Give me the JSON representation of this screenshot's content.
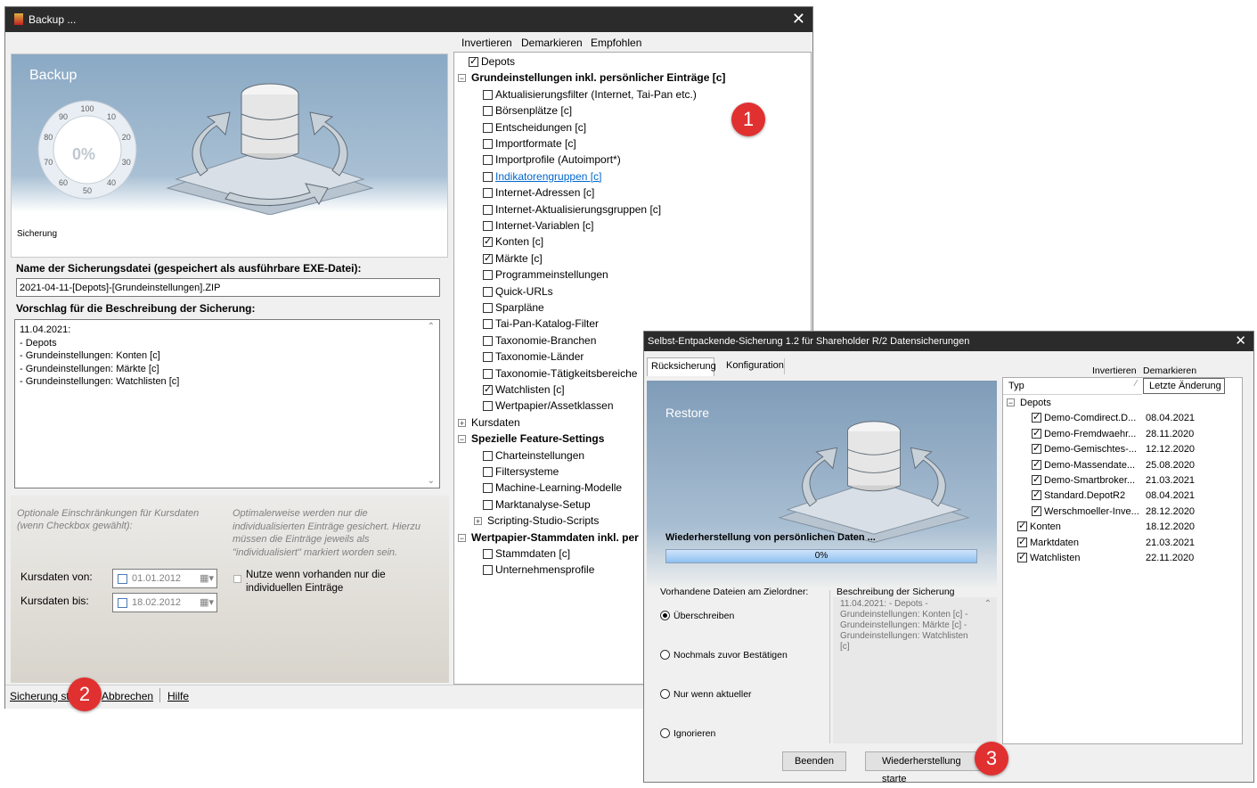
{
  "backup_window": {
    "title": "Backup ...",
    "banner_title": "Backup",
    "gauge_percent": "0%",
    "gauge_ticks": [
      "100",
      "10",
      "20",
      "30",
      "40",
      "50",
      "60",
      "70",
      "80",
      "90"
    ],
    "banner_status": "Sicherung",
    "file_label": "Name der Sicherungsdatei (gespeichert als ausführbare EXE-Datei):",
    "file_value": "2021-04-11-[Depots]-[Grundeinstellungen].ZIP",
    "desc_label": "Vorschlag für die Beschreibung der Sicherung:",
    "desc_lines": [
      "11.04.2021:",
      "- Depots",
      "- Grundeinstellungen: Konten [c]",
      "- Grundeinstellungen: Märkte [c]",
      "- Grundeinstellungen: Watchlisten [c]"
    ],
    "opt_left": "Optionale Einschränkungen für Kursdaten (wenn Checkbox gewählt):",
    "opt_right": "Optimalerweise werden nur die individualisierten Einträge gesichert. Hierzu müssen die Einträge jeweils als \"individualisiert\" markiert worden sein.",
    "kurs_von_label": "Kursdaten von:",
    "kurs_von_value": "01.01.2012",
    "kurs_bis_label": "Kursdaten bis:",
    "kurs_bis_value": "18.02.2012",
    "nutze_label": "Nutze wenn vorhanden nur die individuellen Einträge",
    "bottom_buttons": [
      "Sicherung st",
      "Abbrechen",
      "Hilfe"
    ],
    "tree_toolbar": [
      "Invertieren",
      "Demarkieren",
      "Empfohlen"
    ],
    "tree": [
      {
        "label": "Depots",
        "level": 0,
        "kind": "check",
        "checked": true
      },
      {
        "label": "Grundeinstellungen inkl. persönlicher Einträge [c]",
        "level": 0,
        "kind": "group",
        "open": true
      },
      {
        "label": "Aktualisierungsfilter (Internet, Tai-Pan etc.)",
        "level": 1,
        "kind": "check",
        "checked": false
      },
      {
        "label": "Börsenplätze [c]",
        "level": 1,
        "kind": "check",
        "checked": false
      },
      {
        "label": "Entscheidungen [c]",
        "level": 1,
        "kind": "check",
        "checked": false
      },
      {
        "label": "Importformate [c]",
        "level": 1,
        "kind": "check",
        "checked": false
      },
      {
        "label": "Importprofile (Autoimport*)",
        "level": 1,
        "kind": "check",
        "checked": false
      },
      {
        "label": "Indikatorengruppen [c]",
        "level": 1,
        "kind": "check",
        "checked": false,
        "link": true
      },
      {
        "label": "Internet-Adressen [c]",
        "level": 1,
        "kind": "check",
        "checked": false
      },
      {
        "label": "Internet-Aktualisierungsgruppen [c]",
        "level": 1,
        "kind": "check",
        "checked": false
      },
      {
        "label": "Internet-Variablen [c]",
        "level": 1,
        "kind": "check",
        "checked": false
      },
      {
        "label": "Konten [c]",
        "level": 1,
        "kind": "check",
        "checked": true
      },
      {
        "label": "Märkte [c]",
        "level": 1,
        "kind": "check",
        "checked": true
      },
      {
        "label": "Programmeinstellungen",
        "level": 1,
        "kind": "check",
        "checked": false
      },
      {
        "label": "Quick-URLs",
        "level": 1,
        "kind": "check",
        "checked": false
      },
      {
        "label": "Sparpläne",
        "level": 1,
        "kind": "check",
        "checked": false
      },
      {
        "label": "Tai-Pan-Katalog-Filter",
        "level": 1,
        "kind": "check",
        "checked": false
      },
      {
        "label": "Taxonomie-Branchen",
        "level": 1,
        "kind": "check",
        "checked": false
      },
      {
        "label": "Taxonomie-Länder",
        "level": 1,
        "kind": "check",
        "checked": false
      },
      {
        "label": "Taxonomie-Tätigkeitsbereiche",
        "level": 1,
        "kind": "check",
        "checked": false
      },
      {
        "label": "Watchlisten [c]",
        "level": 1,
        "kind": "check",
        "checked": true
      },
      {
        "label": "Wertpapier/Assetklassen",
        "level": 1,
        "kind": "check",
        "checked": false
      },
      {
        "label": "Kursdaten",
        "level": 0,
        "kind": "group",
        "open": false,
        "bold": false
      },
      {
        "label": "Spezielle Feature-Settings",
        "level": 0,
        "kind": "group",
        "open": true
      },
      {
        "label": "Charteinstellungen",
        "level": 1,
        "kind": "check",
        "checked": false
      },
      {
        "label": "Filtersysteme",
        "level": 1,
        "kind": "check",
        "checked": false
      },
      {
        "label": "Machine-Learning-Modelle",
        "level": 1,
        "kind": "check",
        "checked": false
      },
      {
        "label": "Marktanalyse-Setup",
        "level": 1,
        "kind": "check",
        "checked": false
      },
      {
        "label": "Scripting-Studio-Scripts",
        "level": 1,
        "kind": "group",
        "open": false,
        "bold": false
      },
      {
        "label": "Wertpapier-Stammdaten inkl. per",
        "level": 0,
        "kind": "group",
        "open": true
      },
      {
        "label": "Stammdaten [c]",
        "level": 1,
        "kind": "check",
        "checked": false
      },
      {
        "label": "Unternehmensprofile",
        "level": 1,
        "kind": "check",
        "checked": false
      }
    ]
  },
  "restore_window": {
    "title": "Selbst-Entpackende-Sicherung 1.2 für Shareholder R/2 Datensicherungen",
    "tabs": [
      "Rücksicherung",
      "Konfiguration"
    ],
    "toolbar": [
      "Invertieren",
      "Demarkieren"
    ],
    "banner_title": "Restore",
    "progress_label": "Wiederherstellung von persönlichen Daten ...",
    "progress_text": "0%",
    "progress_value": 0,
    "existing_label": "Vorhandene Dateien am Zielordner:",
    "radios": [
      {
        "label": "Überschreiben",
        "checked": true
      },
      {
        "label": "Nochmals zuvor Bestätigen",
        "checked": false
      },
      {
        "label": "Nur wenn aktueller",
        "checked": false
      },
      {
        "label": "Ignorieren",
        "checked": false
      }
    ],
    "desc_label": "Beschreibung der Sicherung",
    "desc_text": "11.04.2021: - Depots - Grundeinstellungen: Konten [c] - Grundeinstellungen: Märkte [c] - Grundeinstellungen: Watchlisten [c]",
    "columns": [
      "Typ",
      "Letzte Änderung"
    ],
    "rows": [
      {
        "label": "Depots",
        "level": 0,
        "kind": "group",
        "date": ""
      },
      {
        "label": "Demo-Comdirect.D...",
        "level": 1,
        "kind": "check",
        "date": "08.04.2021"
      },
      {
        "label": "Demo-Fremdwaehr...",
        "level": 1,
        "kind": "check",
        "date": "28.11.2020"
      },
      {
        "label": "Demo-Gemischtes-...",
        "level": 1,
        "kind": "check",
        "date": "12.12.2020"
      },
      {
        "label": "Demo-Massendate...",
        "level": 1,
        "kind": "check",
        "date": "25.08.2020"
      },
      {
        "label": "Demo-Smartbroker...",
        "level": 1,
        "kind": "check",
        "date": "21.03.2021"
      },
      {
        "label": "Standard.DepotR2",
        "level": 1,
        "kind": "check",
        "date": "08.04.2021"
      },
      {
        "label": "Werschmoeller-Inve...",
        "level": 1,
        "kind": "check",
        "date": "28.12.2020"
      },
      {
        "label": "Konten",
        "level": 0,
        "kind": "check",
        "date": "18.12.2020"
      },
      {
        "label": "Marktdaten",
        "level": 0,
        "kind": "check",
        "date": "21.03.2021"
      },
      {
        "label": "Watchlisten",
        "level": 0,
        "kind": "check",
        "date": "22.11.2020"
      }
    ],
    "buttons": [
      "Beenden",
      "Wiederherstellung starte"
    ]
  },
  "badges": [
    "1",
    "2",
    "3"
  ],
  "colors": {
    "titlebar": "#2b2b2b",
    "badge": "#e03030",
    "link": "#0066cc",
    "progress": "#5aa0e6"
  }
}
